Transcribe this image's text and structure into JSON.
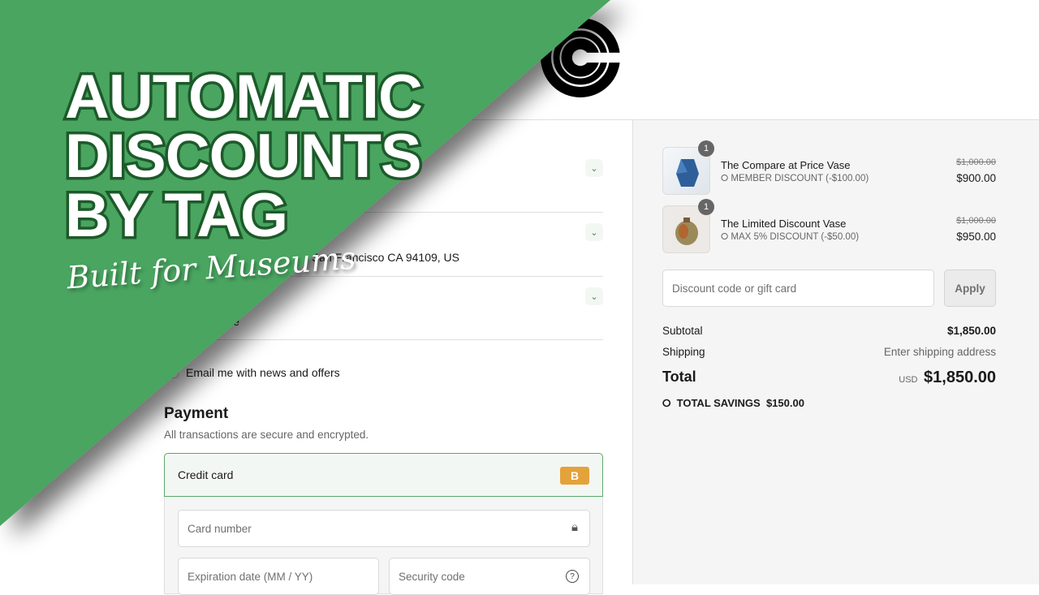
{
  "overlay": {
    "title_lines": [
      "AUTOMATIC",
      "DISCOUNTS",
      "BY TAG"
    ],
    "subtitle": "Built for Museums",
    "green": "#4aa561",
    "outline": "#1d5a2a"
  },
  "checkout": {
    "address_partial": "eet, San Francisco CA 94109, US",
    "shipping_partial": "ee",
    "newsletter_label": "Email me with news and offers",
    "payment_title": "Payment",
    "payment_subtitle": "All transactions are secure and encrypted.",
    "credit_card_label": "Credit card",
    "card_badge": "B",
    "card_number_placeholder": "Card number",
    "expiration_placeholder": "Expiration date (MM / YY)",
    "security_placeholder": "Security code"
  },
  "summary": {
    "items": [
      {
        "name": "The Compare at Price Vase",
        "qty": "1",
        "discount": "MEMBER DISCOUNT (-$100.00)",
        "old_price": "$1,000.00",
        "price": "$900.00"
      },
      {
        "name": "The Limited Discount Vase",
        "qty": "1",
        "discount": "MAX 5% DISCOUNT (-$50.00)",
        "old_price": "$1,000.00",
        "price": "$950.00"
      }
    ],
    "discount_placeholder": "Discount code or gift card",
    "apply_label": "Apply",
    "subtotal_label": "Subtotal",
    "subtotal": "$1,850.00",
    "shipping_label": "Shipping",
    "shipping": "Enter shipping address",
    "total_label": "Total",
    "currency": "USD",
    "total": "$1,850.00",
    "savings_label": "TOTAL SAVINGS",
    "savings": "$150.00"
  }
}
